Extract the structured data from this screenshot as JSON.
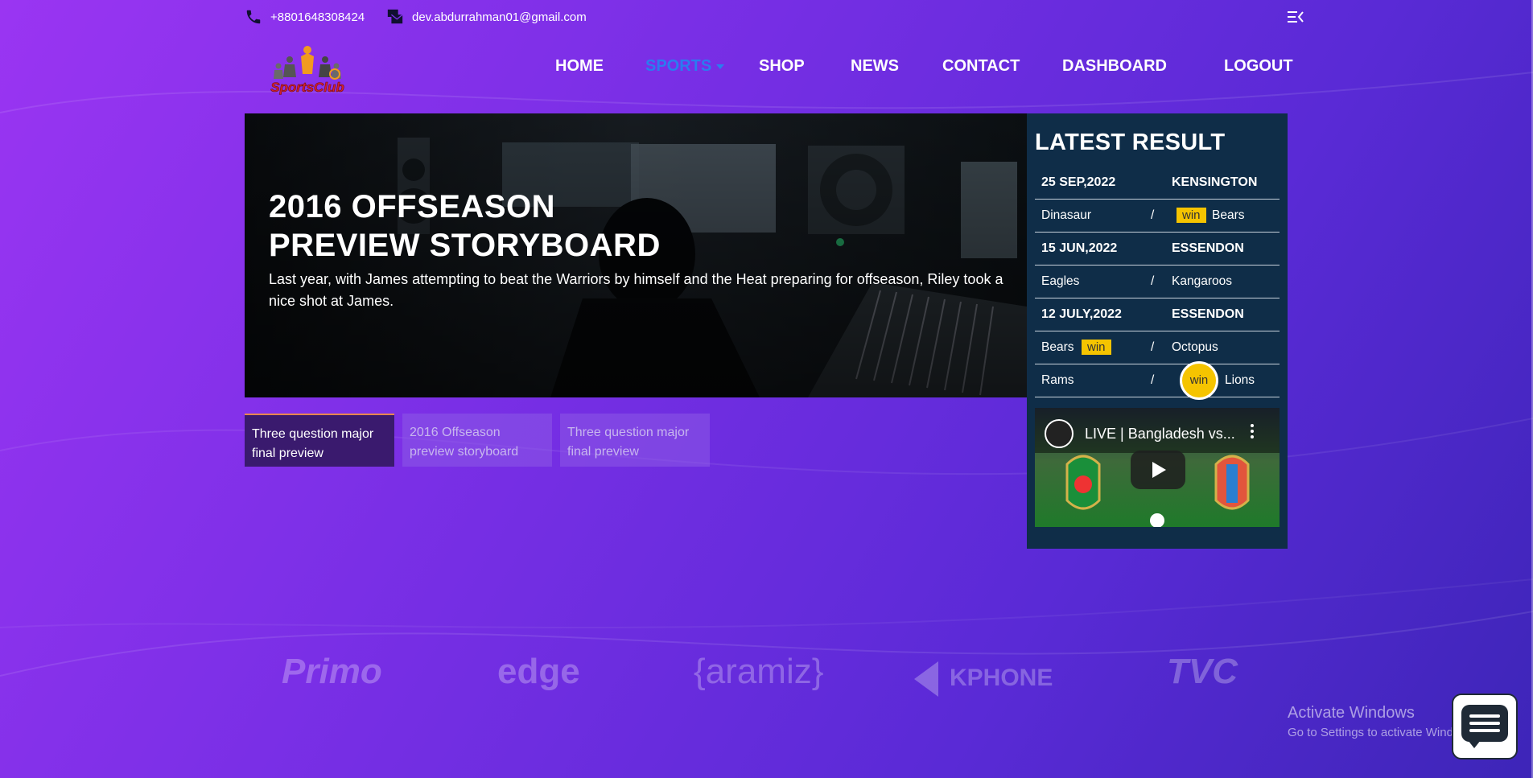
{
  "contact": {
    "phone": "+8801648308424",
    "email": "dev.abdurrahman01@gmail.com"
  },
  "logo_text": "SportsClub",
  "nav": {
    "home": "HOME",
    "sports": "SPORTS",
    "shop": "SHOP",
    "news": "NEWS",
    "contact": "CONTACT",
    "dashboard": "DASHBOARD",
    "logout": "LOGOUT"
  },
  "hero": {
    "title_line1": "2016 OFFSEASON",
    "title_line2": "PREVIEW STORYBOARD",
    "description": "Last year, with James attempting to beat the Warriors by himself and the Heat preparing for offseason, Riley took a nice shot at James."
  },
  "tabs": [
    {
      "label": "Three question major final preview"
    },
    {
      "label": "2016 Offseason preview storyboard"
    },
    {
      "label": "Three question major final preview"
    }
  ],
  "results": {
    "title": "LATEST RESULT",
    "separator": "/",
    "win_label": "win",
    "rows": [
      {
        "date": "25 SEP,2022",
        "venue": "KENSINGTON"
      },
      {
        "team1": "Dinasaur",
        "team2": "Bears"
      },
      {
        "date": "15 JUN,2022",
        "venue": "ESSENDON"
      },
      {
        "team1": "Eagles",
        "team2": "Kangaroos"
      },
      {
        "date": "12 JULY,2022",
        "venue": "ESSENDON"
      },
      {
        "team1": "Bears",
        "team2": "Octopus"
      },
      {
        "team1": "Rams",
        "team2": "Lions"
      }
    ]
  },
  "video": {
    "title": "LIVE | Bangladesh vs..."
  },
  "partners": [
    "Primo",
    "edge",
    "{aramiz}",
    "KPHONE",
    "TVC"
  ],
  "windows_notice": {
    "line1": "Activate Windows",
    "line2": "Go to Settings to activate Windows."
  },
  "colors": {
    "accent_blue": "#2a7cf0",
    "win_badge": "#f5c400",
    "panel_bg": "#0f2d48"
  }
}
